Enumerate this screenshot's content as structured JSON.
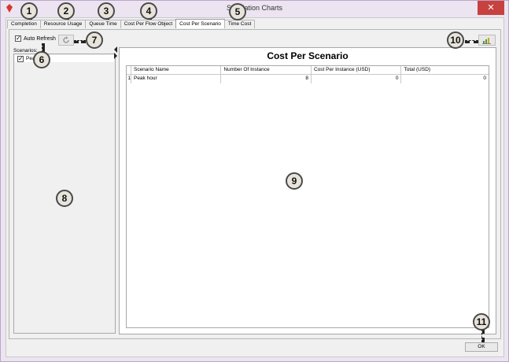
{
  "window": {
    "title": "Simulation Charts",
    "close_glyph": "✕"
  },
  "tabs": [
    {
      "label": "Completion"
    },
    {
      "label": "Resource Usage"
    },
    {
      "label": "Queue Time"
    },
    {
      "label": "Cost Per Flow Object"
    },
    {
      "label": "Cost Per Scenario",
      "active": true
    },
    {
      "label": "Time Cost"
    }
  ],
  "toolbar": {
    "auto_refresh_label": "Auto Refresh",
    "auto_refresh_checked": true
  },
  "scenarios": {
    "label": "Scenarios:",
    "items": [
      {
        "label": "Peak hour",
        "checked": true
      }
    ]
  },
  "chart": {
    "title": "Cost Per Scenario",
    "columns": [
      "Scenario Name",
      "Number Of Instance",
      "Cost Per Instance (USD)",
      "Total (USD)"
    ],
    "rows": [
      {
        "index": "1",
        "name": "Peak hour",
        "instances": "8",
        "cost_per_instance": "0",
        "total": "0"
      }
    ]
  },
  "footer": {
    "ok_label": "OK"
  },
  "badges": [
    "1",
    "2",
    "3",
    "4",
    "5",
    "6",
    "7",
    "8",
    "9",
    "10",
    "11"
  ],
  "icons": {
    "refresh": "refresh-icon",
    "export": "export-chart-icon",
    "app": "app-logo-icon"
  },
  "colors": {
    "close": "#c7413f",
    "frame": "#ece4f1"
  }
}
